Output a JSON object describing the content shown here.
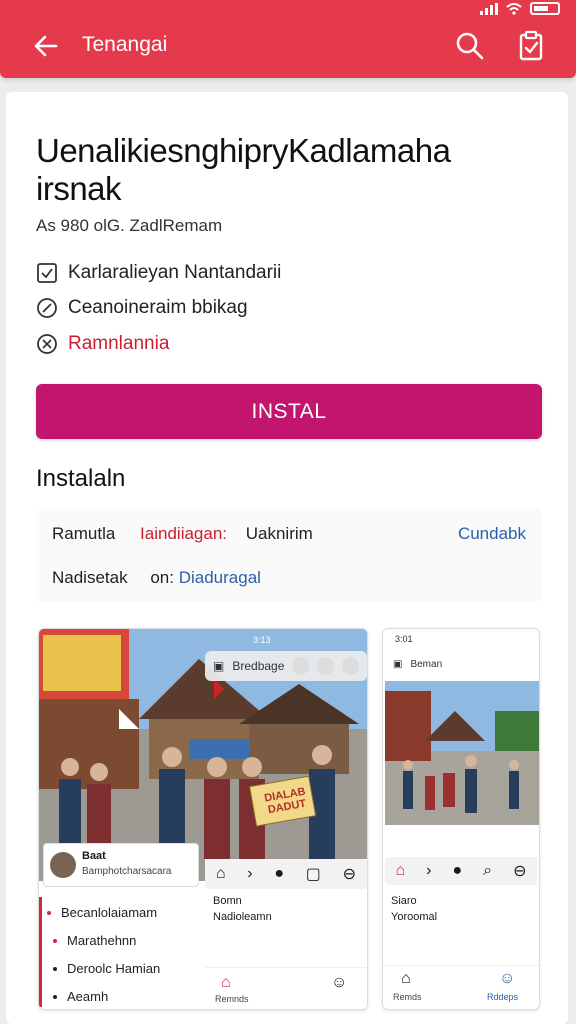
{
  "header": {
    "title": "Tenangai",
    "bar_color": "#e53a4c"
  },
  "app": {
    "title": "UenalikiesnghipryKadlamaha irsnak",
    "meta": "As 980 olG. ZadlRemam",
    "features": [
      {
        "icon": "checkbox-icon",
        "label": "Karlaralieyan Nantandarii"
      },
      {
        "icon": "edit-circle-icon",
        "label": "Ceanoineraim bbikag"
      },
      {
        "icon": "alert-circle-icon",
        "label": "Ramnlannia"
      }
    ],
    "install_label": "INSTAL",
    "accent": "#c2166e"
  },
  "install_section": {
    "title": "Instalaln",
    "row1": {
      "label": "Ramutla",
      "red_value": "Iaindiiagan:",
      "value": "Uaknirim",
      "link": "Cundabk"
    },
    "row2": {
      "label": "Nadisetak",
      "prefix": "on:",
      "link": "Diaduragal"
    }
  },
  "screenshots": {
    "shot1": {
      "status_time": "3:13",
      "top_bar_label": "Bredbage",
      "banner_text": "DIALAB DADUT",
      "profile_name": "Baat",
      "profile_sub": "Bamphotcharsacara",
      "list": [
        "Becanlolaiamam",
        "Marathehnn",
        "Deroolc Hamian",
        "Aeamh"
      ],
      "side_title": "Bomn",
      "side_sub": "Nadioleamn",
      "nav_label": "Remnds"
    },
    "shot2": {
      "status_time": "3:01",
      "top_bar_label": "Beman",
      "title": "Siaro",
      "sub": "Yoroomal",
      "nav_left": "Remds",
      "nav_right": "Rddeps"
    }
  }
}
